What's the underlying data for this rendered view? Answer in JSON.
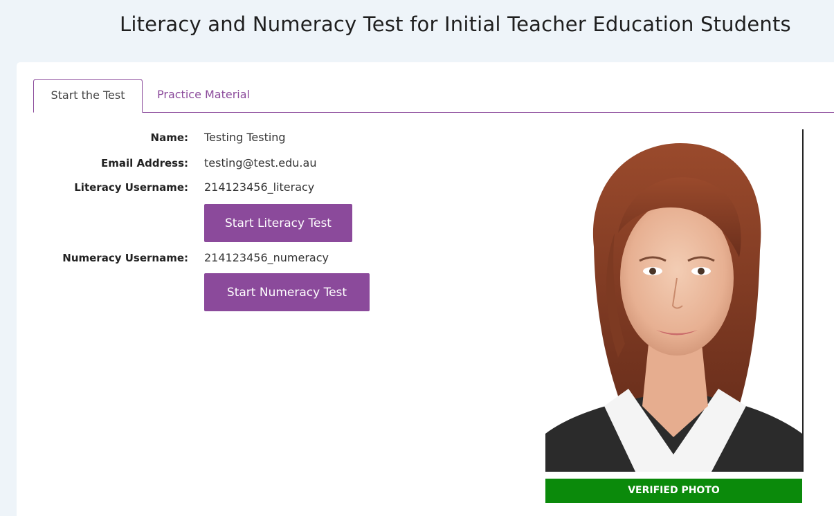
{
  "header": {
    "title": "Literacy and Numeracy Test for Initial Teacher Education Students"
  },
  "tabs": [
    {
      "label": "Start the Test",
      "active": true
    },
    {
      "label": "Practice Material",
      "active": false
    }
  ],
  "student": {
    "name_label": "Name:",
    "name_value": "Testing Testing",
    "email_label": "Email Address:",
    "email_value": "testing@test.edu.au",
    "literacy_label": "Literacy Username:",
    "literacy_value": "214123456_literacy",
    "numeracy_label": "Numeracy Username:",
    "numeracy_value": "214123456_numeracy"
  },
  "buttons": {
    "start_literacy": "Start Literacy Test",
    "start_numeracy": "Start Numeracy Test"
  },
  "photo": {
    "badge_label": "VERIFIED PHOTO",
    "badge_color": "#0b8a0b"
  },
  "colors": {
    "accent": "#8b4a9b",
    "page_background": "#eef4f9",
    "card_background": "#ffffff"
  }
}
